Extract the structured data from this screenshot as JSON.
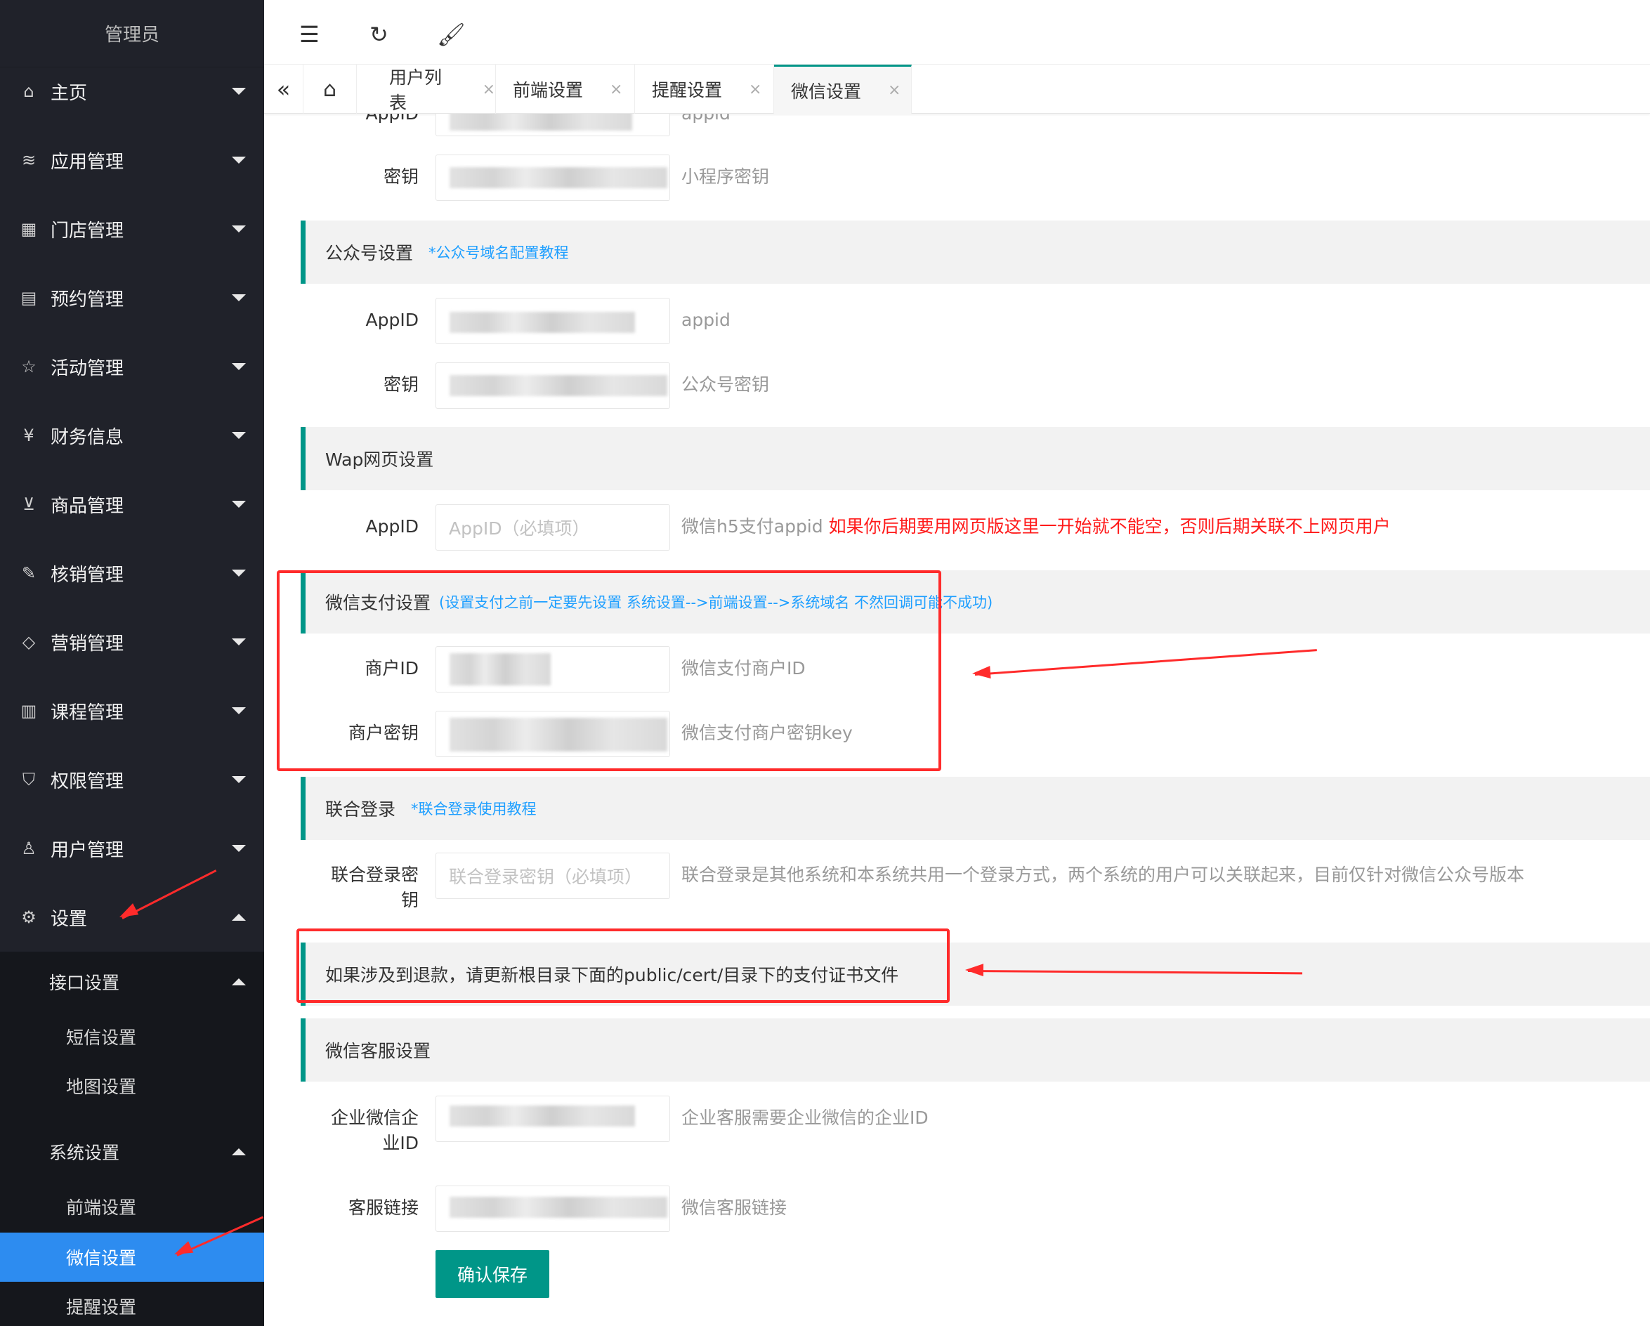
{
  "sidebar": {
    "title": "管理员",
    "items": [
      {
        "label": "主页",
        "icon": "home-icon",
        "glyph": "⌂"
      },
      {
        "label": "应用管理",
        "icon": "layers-icon",
        "glyph": "≋"
      },
      {
        "label": "门店管理",
        "icon": "apps-icon",
        "glyph": "▦"
      },
      {
        "label": "预约管理",
        "icon": "calendar-icon",
        "glyph": "▤"
      },
      {
        "label": "活动管理",
        "icon": "star-icon",
        "glyph": "☆"
      },
      {
        "label": "财务信息",
        "icon": "yen-icon",
        "glyph": "¥"
      },
      {
        "label": "商品管理",
        "icon": "cart-icon",
        "glyph": "⊻"
      },
      {
        "label": "核销管理",
        "icon": "edit-icon",
        "glyph": "✎"
      },
      {
        "label": "营销管理",
        "icon": "diamond-icon",
        "glyph": "◇"
      },
      {
        "label": "课程管理",
        "icon": "book-icon",
        "glyph": "▥"
      },
      {
        "label": "权限管理",
        "icon": "shield-icon",
        "glyph": "⛉"
      },
      {
        "label": "用户管理",
        "icon": "user-icon",
        "glyph": "♙"
      },
      {
        "label": "设置",
        "icon": "gear-icon",
        "glyph": "⚙"
      }
    ],
    "interface_group": "接口设置",
    "interface_items": [
      "短信设置",
      "地图设置"
    ],
    "system_group": "系统设置",
    "system_items": [
      "前端设置",
      "微信设置",
      "提醒设置"
    ]
  },
  "header": {
    "icons": [
      "menu-fold-icon",
      "refresh-icon",
      "clear-cache-icon"
    ]
  },
  "tabs": {
    "items": [
      "用户列表",
      "前端设置",
      "提醒设置",
      "微信设置"
    ],
    "active": "微信设置"
  },
  "form": {
    "top_appid_label": "AppID",
    "top_appid_hint": "appid",
    "mini_secret_label": "密钥",
    "mini_secret_hint": "小程序密钥",
    "official_section": "公众号设置",
    "official_link": "*公众号域名配置教程",
    "official_appid_label": "AppID",
    "official_appid_hint": "appid",
    "official_secret_label": "密钥",
    "official_secret_hint": "公众号密钥",
    "wap_section": "Wap网页设置",
    "wap_appid_label": "AppID",
    "wap_appid_placeholder": "AppID（必填项）",
    "wap_appid_hint": "微信h5支付appid",
    "wap_appid_warning": "如果你后期要用网页版这里一开始就不能空，否则后期关联不上网页用户",
    "pay_section": "微信支付设置",
    "pay_link": "(设置支付之前一定要先设置 系统设置-->前端设置-->系统域名 不然回调可能不成功)",
    "mch_id_label": "商户ID",
    "mch_id_hint": "微信支付商户ID",
    "mch_key_label": "商户密钥",
    "mch_key_hint": "微信支付商户密钥key",
    "union_section": "联合登录",
    "union_link": "*联合登录使用教程",
    "union_key_label_1": "联合登录密",
    "union_key_label_2": "钥",
    "union_key_placeholder": "联合登录密钥（必填项）",
    "union_key_hint": "联合登录是其他系统和本系统共用一个登录方式，两个系统的用户可以关联起来，目前仅针对微信公众号版本",
    "refund_notice": "如果涉及到退款，请更新根目录下面的public/cert/目录下的支付证书文件",
    "kf_section": "微信客服设置",
    "corp_id_label_1": "企业微信企",
    "corp_id_label_2": "业ID",
    "corp_id_hint": "企业客服需要企业微信的企业ID",
    "kf_link_label": "客服链接",
    "kf_link_hint": "微信客服链接",
    "save_button": "确认保存"
  },
  "colors": {
    "sidebar_bg": "#20222A",
    "active_blue": "#2D8CF0",
    "primary_green": "#009688",
    "link_blue": "#1E9FFF",
    "annotation_red": "#FF2B2B"
  }
}
